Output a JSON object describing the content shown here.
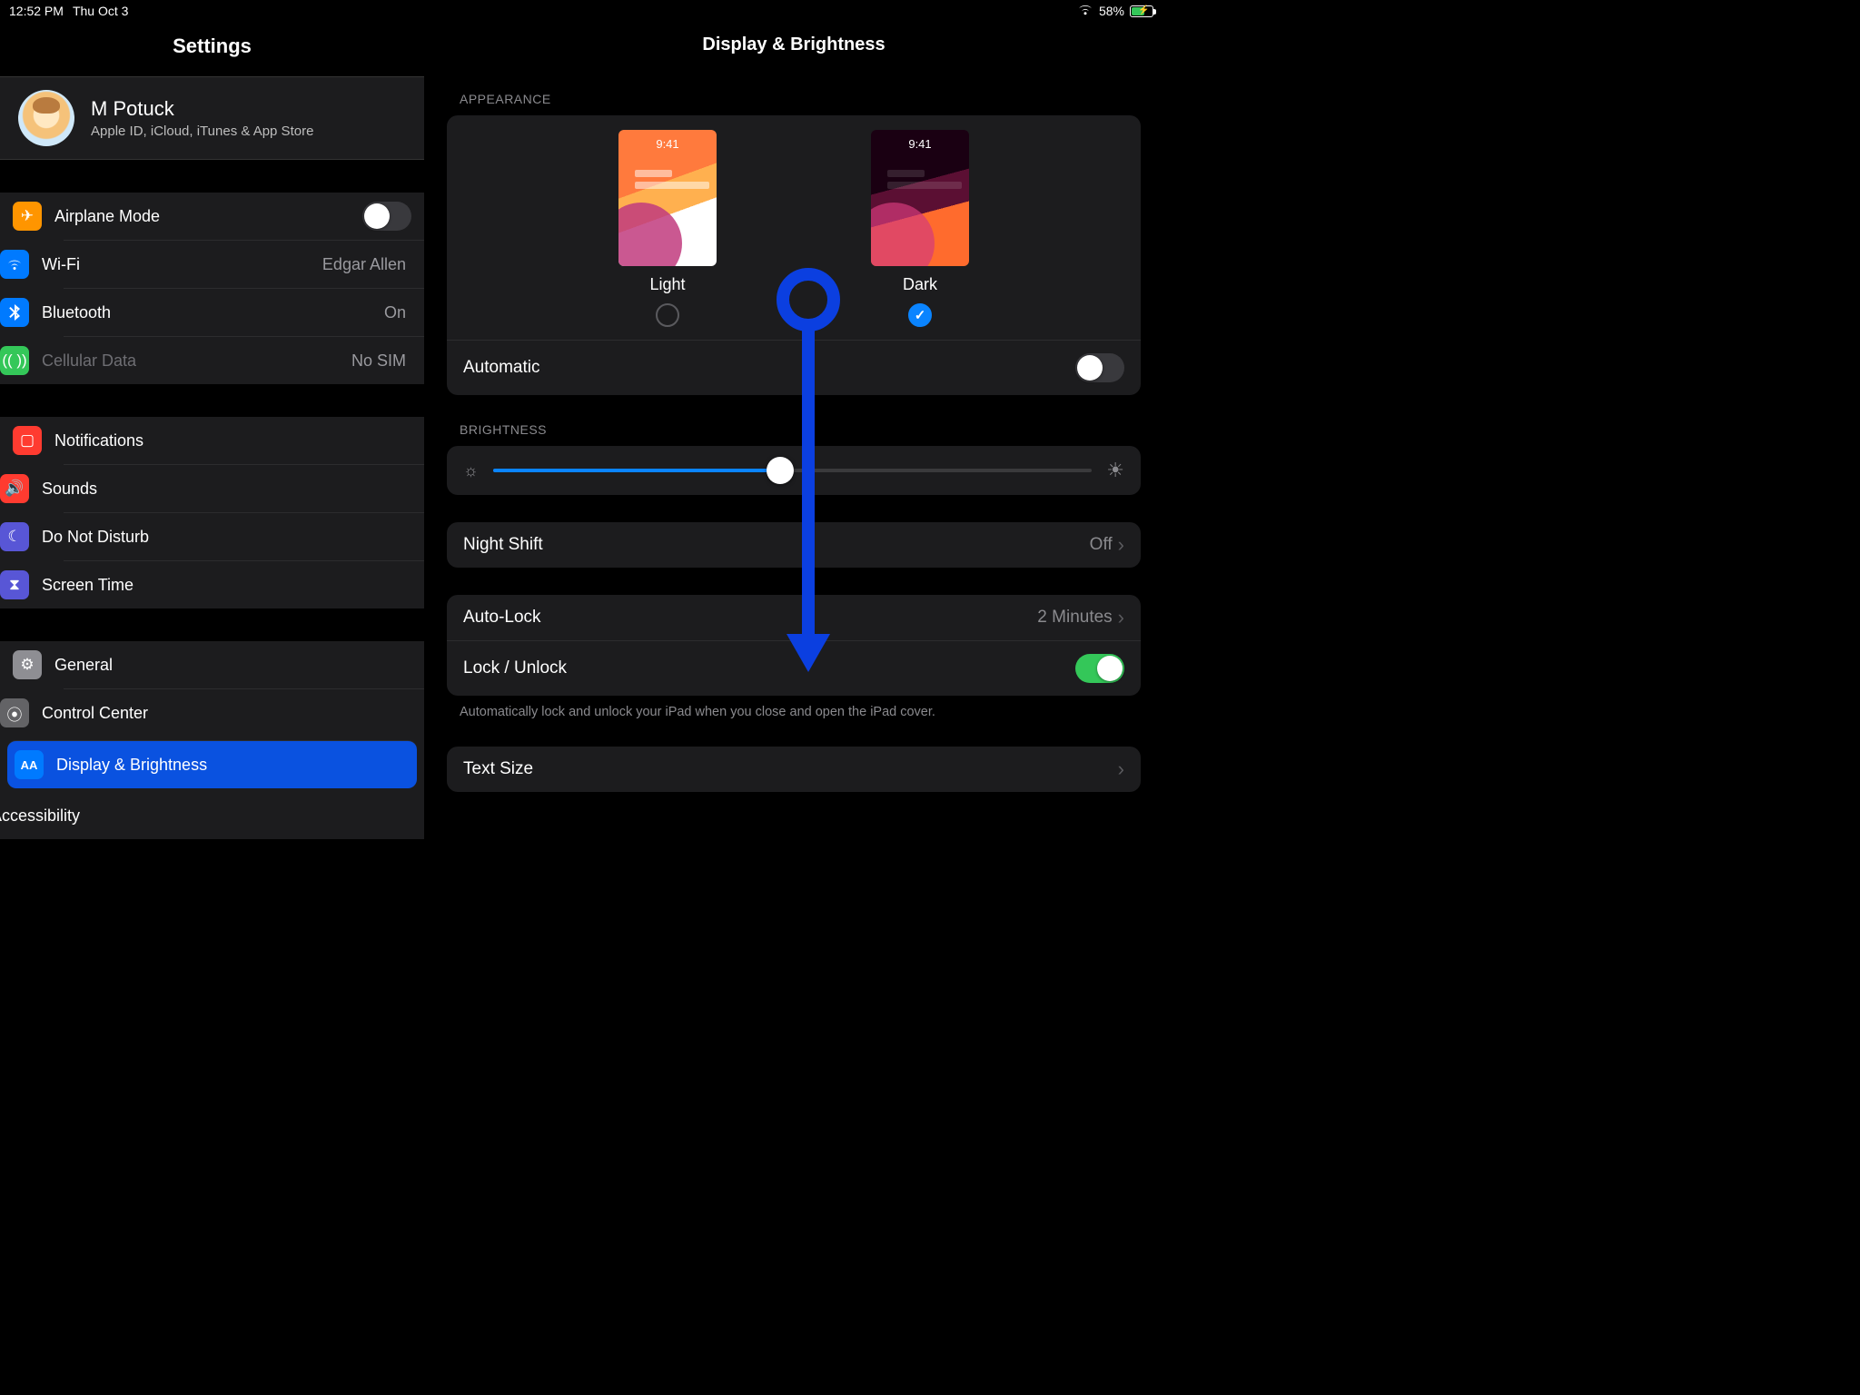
{
  "status": {
    "time": "12:52 PM",
    "date": "Thu Oct 3",
    "battery_pct": "58%"
  },
  "sidebar": {
    "title": "Settings",
    "user": {
      "name": "M Potuck",
      "subtitle": "Apple ID, iCloud, iTunes & App Store"
    },
    "rows": {
      "airplane": "Airplane Mode",
      "wifi": "Wi-Fi",
      "wifi_value": "Edgar Allen",
      "bluetooth": "Bluetooth",
      "bluetooth_value": "On",
      "cellular": "Cellular Data",
      "cellular_value": "No SIM",
      "notifications": "Notifications",
      "sounds": "Sounds",
      "dnd": "Do Not Disturb",
      "screentime": "Screen Time",
      "general": "General",
      "controlcenter": "Control Center",
      "display": "Display & Brightness",
      "accessibility": "Accessibility"
    }
  },
  "detail": {
    "title": "Display & Brightness",
    "appearance_label": "Appearance",
    "light_label": "Light",
    "dark_label": "Dark",
    "preview_time": "9:41",
    "automatic_label": "Automatic",
    "brightness_label": "Brightness",
    "nightshift_label": "Night Shift",
    "nightshift_value": "Off",
    "autolock_label": "Auto-Lock",
    "autolock_value": "2 Minutes",
    "lockunlock_label": "Lock / Unlock",
    "lockunlock_note": "Automatically lock and unlock your iPad when you close and open the iPad cover.",
    "textsize_label": "Text Size"
  }
}
